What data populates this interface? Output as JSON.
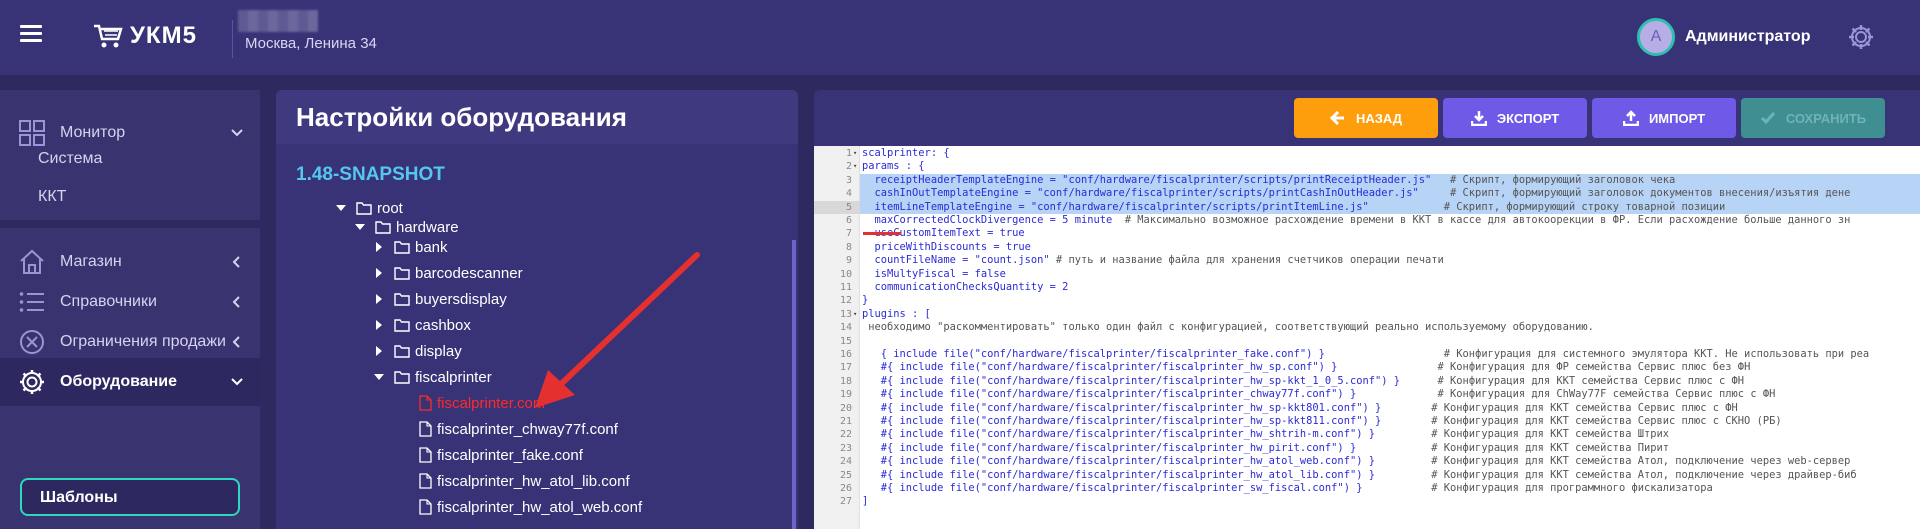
{
  "header": {
    "logo_text": "УКМ5",
    "address": "Москва, Ленина 34",
    "avatar_letter": "А",
    "user_name": "Администратор",
    "accent": "#2fbfae"
  },
  "sidebar": {
    "monitor": "Монитор",
    "system": "Система",
    "kkt": "ККТ",
    "shop": "Магазин",
    "directories": "Справочники",
    "sale_limits": "Ограничения продажи",
    "equipment": "Оборудование",
    "templates": "Шаблоны"
  },
  "tree": {
    "title": "Настройки оборудования",
    "version": "1.48-SNAPSHOT",
    "nodes": [
      {
        "label": "root"
      },
      {
        "label": "hardware"
      },
      {
        "label": "bank"
      },
      {
        "label": "barcodescanner"
      },
      {
        "label": "buyersdisplay"
      },
      {
        "label": "cashbox"
      },
      {
        "label": "display"
      },
      {
        "label": "fiscalprinter"
      },
      {
        "label": "fiscalprinter.conf"
      },
      {
        "label": "fiscalprinter_chway77f.conf"
      },
      {
        "label": "fiscalprinter_fake.conf"
      },
      {
        "label": "fiscalprinter_hw_atol_lib.conf"
      },
      {
        "label": "fiscalprinter_hw_atol_web.conf"
      }
    ]
  },
  "toolbar": {
    "back": "НАЗАД",
    "export": "ЭКСПОРТ",
    "import": "ИМПОРТ",
    "save": "СОХРАНИТЬ",
    "back_color": "#ff9e0c",
    "action_color": "#6e5ae6"
  },
  "editor": {
    "lines": [
      {
        "n": "1",
        "t": "scalprinter: {"
      },
      {
        "n": "2",
        "t": "params : {"
      },
      {
        "n": "3",
        "t": "  receiptHeaderTemplateEngine = \"conf/hardware/fiscalprinter/scripts/printReceiptHeader.js\"   # Скрипт, формирующий заголовок чека"
      },
      {
        "n": "4",
        "t": "  cashInOutTemplateEngine = \"conf/hardware/fiscalprinter/scripts/printCashInOutHeader.js\"     # Скрипт, формирующий заголовок документов внесения/изъятия дене"
      },
      {
        "n": "5",
        "t": "  itemLineTemplateEngine = \"conf/hardware/fiscalprinter/scripts/printItemLine.js\"            # Скрипт, формирующий строку товарной позиции"
      },
      {
        "n": "6",
        "t": "  maxCorrectedClockDivergence = 5 minute  # Максимально возможное расхождение времени в ККТ в кассе для автокоорекции в ФР. Если расхождение больше данного зн"
      },
      {
        "n": "7",
        "t": "  useCustomItemText = true"
      },
      {
        "n": "8",
        "t": "  priceWithDiscounts = true"
      },
      {
        "n": "9",
        "t": "  countFileName = \"count.json\" # путь и название файла для хранения счетчиков операции печати"
      },
      {
        "n": "10",
        "t": "  isMultyFiscal = false"
      },
      {
        "n": "11",
        "t": "  communicationChecksQuantity = 2"
      },
      {
        "n": "12",
        "t": "}"
      },
      {
        "n": "13",
        "t": "plugins : ["
      },
      {
        "n": "14",
        "t": " необходимо \"раскомментировать\" только один файл с конфигурацией, соответствующий реально используемому оборудованию."
      },
      {
        "n": "15",
        "t": ""
      },
      {
        "n": "16",
        "t": "   { include file(\"conf/hardware/fiscalprinter/fiscalprinter_fake.conf\") }                   # Конфигурация для системного эмулятора ККТ. Не использовать при реа"
      },
      {
        "n": "17",
        "t": "   #{ include file(\"conf/hardware/fiscalprinter/fiscalprinter_hw_sp.conf\") }                # Конфигурация для ФР семейства Сервис плюс без ФН"
      },
      {
        "n": "18",
        "t": "   #{ include file(\"conf/hardware/fiscalprinter/fiscalprinter_hw_sp-kkt_1_0_5.conf\") }      # Конфигурация для ККТ семейства Сервис плюс с ФН"
      },
      {
        "n": "19",
        "t": "   #{ include file(\"conf/hardware/fiscalprinter/fiscalprinter_chway77f.conf\") }             # Конфигурация для ChWay77F семейства Сервис плюс с ФН"
      },
      {
        "n": "20",
        "t": "   #{ include file(\"conf/hardware/fiscalprinter/fiscalprinter_hw_sp-kkt801.conf\") }        # Конфигурация для ККТ семейства Сервис плюс с ФН"
      },
      {
        "n": "21",
        "t": "   #{ include file(\"conf/hardware/fiscalprinter/fiscalprinter_hw_sp-kkt811.conf\") }        # Конфигурация для ККТ семейства Сервис плюс с СКНО (РБ)"
      },
      {
        "n": "22",
        "t": "   #{ include file(\"conf/hardware/fiscalprinter/fiscalprinter_hw_shtrih-m.conf\") }         # Конфигурация для ККТ семейства Штрих"
      },
      {
        "n": "23",
        "t": "   #{ include file(\"conf/hardware/fiscalprinter/fiscalprinter_hw_pirit.conf\") }            # Конфигурация для ККТ семейства Пирит"
      },
      {
        "n": "24",
        "t": "   #{ include file(\"conf/hardware/fiscalprinter/fiscalprinter_hw_atol_web.conf\") }         # Конфигурация для ККТ семейства Атол, подключение через web-сервер"
      },
      {
        "n": "25",
        "t": "   #{ include file(\"conf/hardware/fiscalprinter/fiscalprinter_hw_atol_lib.conf\") }         # Конфигурация для ККТ семейства Атол, подключение через драйвер-биб"
      },
      {
        "n": "26",
        "t": "   #{ include file(\"conf/hardware/fiscalprinter/fiscalprinter_sw_fiscal.conf\") }           # Конфигурация для программного фискализатора"
      },
      {
        "n": "27",
        "t": "]"
      }
    ]
  }
}
